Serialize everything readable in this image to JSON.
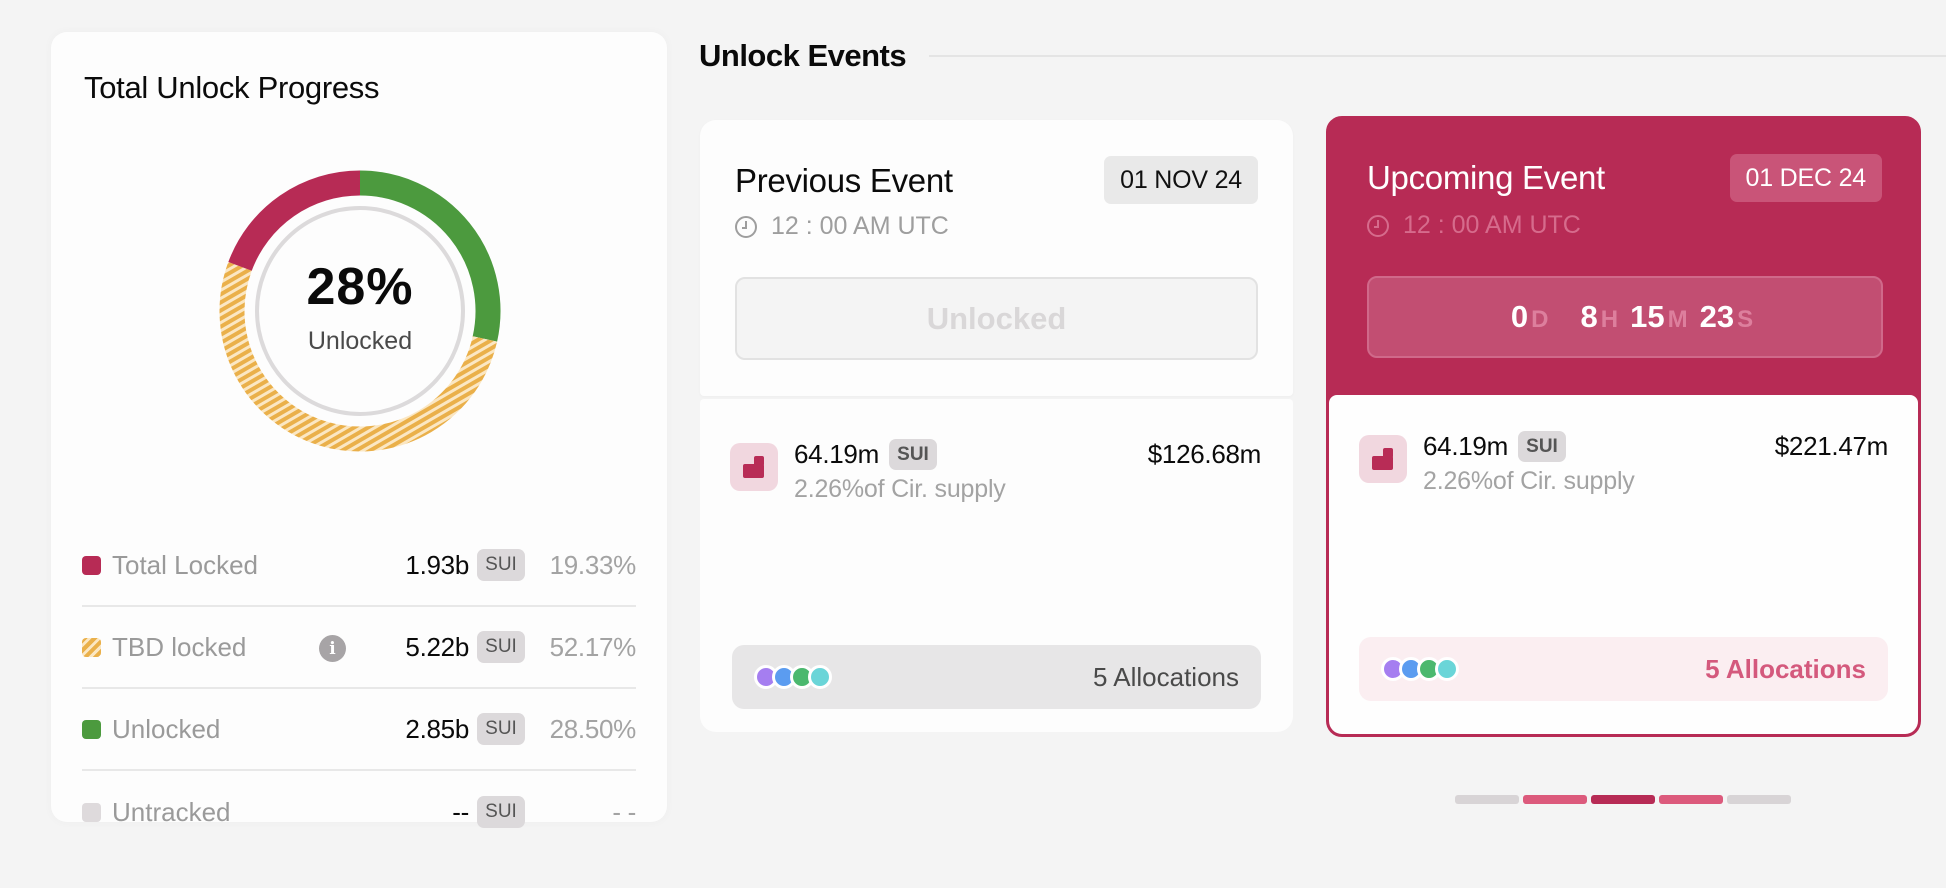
{
  "progress": {
    "title": "Total Unlock Progress",
    "center_value": "28%",
    "center_label": "Unlocked",
    "legend": [
      {
        "label": "Total Locked",
        "amount": "1.93b",
        "token": "SUI",
        "percent": "19.33%",
        "color": "#b72b55",
        "style": "solid",
        "info": false
      },
      {
        "label": "TBD locked",
        "amount": "5.22b",
        "token": "SUI",
        "percent": "52.17%",
        "color": "#eab04a",
        "style": "hatched",
        "info": true
      },
      {
        "label": "Unlocked",
        "amount": "2.85b",
        "token": "SUI",
        "percent": "28.50%",
        "color": "#4c9a3e",
        "style": "solid",
        "info": false
      },
      {
        "label": "Untracked",
        "amount": "--",
        "token": "SUI",
        "percent": "- -",
        "color": "#dedadc",
        "style": "solid",
        "info": false
      }
    ]
  },
  "chart_data": {
    "type": "pie",
    "variant": "donut",
    "title": "Total Unlock Progress",
    "center_text": "28% Unlocked",
    "start": "12 o'clock, clockwise",
    "slices": [
      {
        "name": "Unlocked",
        "value": 28.5,
        "color": "#4c9a3e",
        "pattern": "solid"
      },
      {
        "name": "TBD locked",
        "value": 52.17,
        "color": "#eab04a",
        "pattern": "hatched"
      },
      {
        "name": "Total Locked",
        "value": 19.33,
        "color": "#b72b55",
        "pattern": "solid"
      },
      {
        "name": "Untracked",
        "value": 0,
        "color": "#dedadc",
        "pattern": "solid"
      }
    ]
  },
  "events": {
    "title": "Unlock Events",
    "previous": {
      "title": "Previous Event",
      "date": "01 NOV 24",
      "time": "12 : 00 AM UTC",
      "status": "Unlocked",
      "amount": "64.19m",
      "token": "SUI",
      "supply": "2.26%of Cir. supply",
      "usd": "$126.68m",
      "allocations": "5 Allocations",
      "dot_colors": [
        "#a57ef0",
        "#5b9cf0",
        "#4bb86e",
        "#6ad5d8"
      ]
    },
    "upcoming": {
      "title": "Upcoming Event",
      "date": "01 DEC 24",
      "time": "12 : 00 AM UTC",
      "countdown": [
        {
          "value": "0",
          "unit": "D"
        },
        {
          "value": "8",
          "unit": "H"
        },
        {
          "value": "15",
          "unit": "M"
        },
        {
          "value": "23",
          "unit": "S"
        }
      ],
      "amount": "64.19m",
      "token": "SUI",
      "supply": "2.26%of Cir. supply",
      "usd": "$221.47m",
      "allocations": "5 Allocations",
      "dot_colors": [
        "#a57ef0",
        "#5b9cf0",
        "#4bb86e",
        "#6ad5d8"
      ]
    }
  },
  "pager": {
    "count": 5,
    "active_index": 2,
    "colors": [
      "#d8d4d6",
      "#dc5a7c",
      "#b72b55",
      "#dc5a7c",
      "#d8d4d6"
    ]
  }
}
